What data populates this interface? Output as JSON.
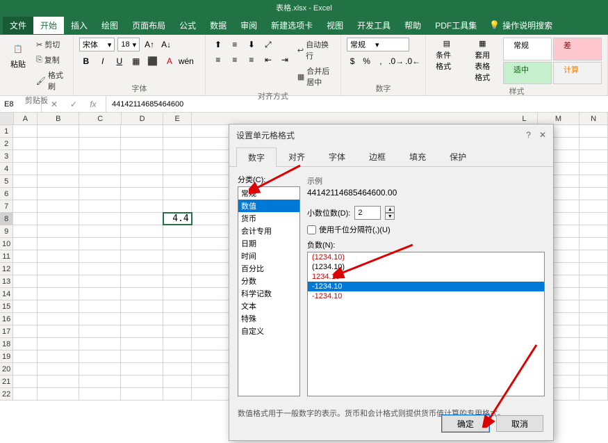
{
  "title": "表格.xlsx - Excel",
  "menu": {
    "file": "文件",
    "home": "开始",
    "insert": "插入",
    "draw": "绘图",
    "layout": "页面布局",
    "formulas": "公式",
    "data": "数据",
    "review": "审阅",
    "newtab": "新建选项卡",
    "view": "视图",
    "dev": "开发工具",
    "help": "帮助",
    "pdf": "PDF工具集",
    "tellme": "操作说明搜索"
  },
  "ribbon": {
    "clipboard": {
      "label": "剪贴板",
      "paste": "粘贴",
      "cut": "剪切",
      "copy": "复制",
      "painter": "格式刷"
    },
    "font": {
      "label": "字体",
      "name": "宋体",
      "size": "18"
    },
    "align": {
      "label": "对齐方式",
      "wrap": "自动换行",
      "merge": "合并后居中"
    },
    "number": {
      "label": "数字",
      "format": "常规"
    },
    "styles": {
      "label": "样式",
      "condfmt": "条件格式",
      "tablefmt": "套用\n表格格式",
      "normal": "常规",
      "bad": "差",
      "good": "适中",
      "calc": "计算"
    }
  },
  "namebox": "E8",
  "formula": "44142114685464600",
  "columns": [
    "A",
    "B",
    "C",
    "D",
    "E",
    "L",
    "M",
    "N"
  ],
  "rows_visible": 22,
  "active_cell_text": "4.4",
  "dialog": {
    "title": "设置单元格格式",
    "tabs": {
      "number": "数字",
      "align": "对齐",
      "font": "字体",
      "border": "边框",
      "fill": "填充",
      "protect": "保护"
    },
    "category_label": "分类(C):",
    "categories": [
      "常规",
      "数值",
      "货币",
      "会计专用",
      "日期",
      "时间",
      "百分比",
      "分数",
      "科学记数",
      "文本",
      "特殊",
      "自定义"
    ],
    "selected_category_idx": 1,
    "sample_label": "示例",
    "sample_value": "44142114685464600.00",
    "decimals_label": "小数位数(D):",
    "decimals_value": "2",
    "thousands_label": "使用千位分隔符(,)(U)",
    "neg_label": "负数(N):",
    "neg_options": [
      "(1234.10)",
      "(1234.10)",
      "1234.10",
      "-1234.10",
      "-1234.10"
    ],
    "neg_selected_idx": 3,
    "desc": "数值格式用于一般数字的表示。货币和会计格式则提供货币值计算的专用格式。",
    "ok": "确定",
    "cancel": "取消"
  }
}
